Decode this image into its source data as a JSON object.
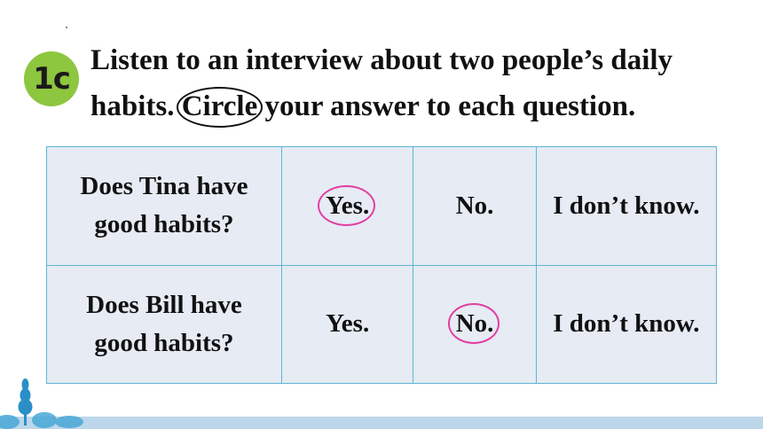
{
  "section_badge": "1c",
  "instruction": {
    "part1": "Listen to an interview about two people’s daily habits. ",
    "circled_word": "Circle",
    "part2": " your answer to each question."
  },
  "table": {
    "rows": [
      {
        "question_line1": "Does Tina have",
        "question_line2": "good habits?",
        "options": [
          "Yes.",
          "No.",
          "I don’t know."
        ],
        "circled_option": "Yes."
      },
      {
        "question_line1": "Does Bill have",
        "question_line2": "good habits?",
        "options": [
          "Yes.",
          "No.",
          "I don’t know."
        ],
        "circled_option": "No."
      }
    ]
  },
  "colors": {
    "badge": "#8dc63f",
    "question_text": "#7a3e9e",
    "table_bg": "#e6ebf4",
    "table_border": "#5cb5d6",
    "answer_circle": "#e23ea0",
    "footer_band": "#bcd6ea"
  }
}
